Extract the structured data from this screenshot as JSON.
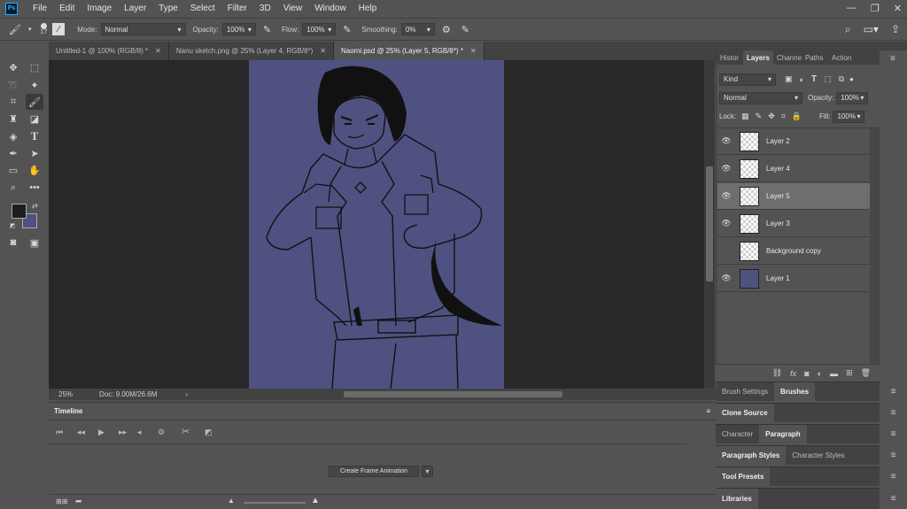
{
  "app": {
    "logo": "Ps"
  },
  "menu": [
    "File",
    "Edit",
    "Image",
    "Layer",
    "Type",
    "Select",
    "Filter",
    "3D",
    "View",
    "Window",
    "Help"
  ],
  "options": {
    "brush_size": "17",
    "mode_label": "Mode:",
    "mode_value": "Normal",
    "opacity_label": "Opacity:",
    "opacity_value": "100%",
    "flow_label": "Flow:",
    "flow_value": "100%",
    "smoothing_label": "Smoothing:",
    "smoothing_value": "0%"
  },
  "tabs": [
    {
      "label": "Untitled-1 @ 100% (RGB/8) *",
      "active": false
    },
    {
      "label": "Nanu sketch.png @ 25% (Layer 4, RGB/8*)",
      "active": false
    },
    {
      "label": "Naomi.psd @ 25% (Layer 5, RGB/8*) *",
      "active": true
    }
  ],
  "status": {
    "zoom": "25%",
    "doc": "Doc: 9.00M/26.6M"
  },
  "timeline": {
    "title": "Timeline",
    "create_button": "Create Frame Animation"
  },
  "layers_panel": {
    "tabs": [
      "Histor",
      "Layers",
      "Channe",
      "Paths",
      "Action"
    ],
    "filter_kind": "Kind",
    "blend_mode": "Normal",
    "opacity_label": "Opacity:",
    "opacity_value": "100%",
    "lock_label": "Lock:",
    "fill_label": "Fill:",
    "fill_value": "100%",
    "layers": [
      {
        "name": "Layer 2",
        "visible": true,
        "selected": false
      },
      {
        "name": "Layer 4",
        "visible": true,
        "selected": false
      },
      {
        "name": "Layer 5",
        "visible": true,
        "selected": true
      },
      {
        "name": "Layer 3",
        "visible": true,
        "selected": false
      },
      {
        "name": "Background copy",
        "visible": false,
        "selected": false
      },
      {
        "name": "Layer 1",
        "visible": true,
        "selected": false
      }
    ]
  },
  "side_panels": {
    "brush_settings": "Brush Settings",
    "brushes": "Brushes",
    "clone_source": "Clone Source",
    "character": "Character",
    "paragraph": "Paragraph",
    "paragraph_styles": "Paragraph Styles",
    "character_styles": "Character Styles",
    "tool_presets": "Tool Presets",
    "libraries": "Libraries"
  },
  "colors": {
    "foreground": "#1e1e1e",
    "background": "#4f5280",
    "canvas_fill": "#4f5280",
    "ui_bg": "#535353"
  },
  "icons": {
    "search": "search-icon",
    "workspace": "workspace-icon",
    "share": "share-icon"
  }
}
